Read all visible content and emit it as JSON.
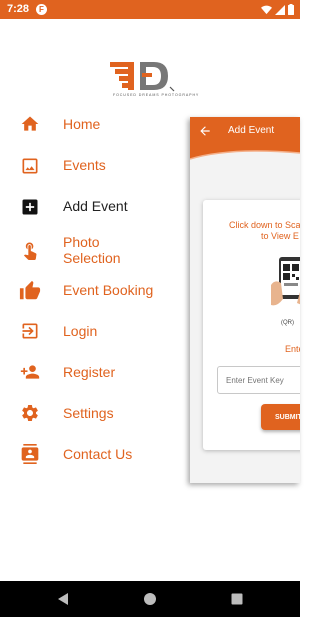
{
  "status_bar": {
    "time": "7:28",
    "app_icon_letter": "F",
    "icons": [
      "wifi-icon",
      "signal-icon",
      "battery-icon"
    ]
  },
  "logo": {
    "tagline": "FOCUSED DREAMS PHOTOGRAPHY",
    "colors": {
      "primary": "#e0631f",
      "secondary": "#777777"
    }
  },
  "menu": {
    "items": [
      {
        "label": "Home",
        "icon": "home-icon",
        "active": false
      },
      {
        "label": "Events",
        "icon": "image-icon",
        "active": false
      },
      {
        "label": "Add Event",
        "icon": "add-box-icon",
        "active": true
      },
      {
        "label": "Photo\nSelection",
        "icon": "touch-icon",
        "active": false
      },
      {
        "label": "Event Booking",
        "icon": "thumbs-up-icon",
        "active": false
      },
      {
        "label": "Login",
        "icon": "login-icon",
        "active": false
      },
      {
        "label": "Register",
        "icon": "person-add-icon",
        "active": false
      },
      {
        "label": "Settings",
        "icon": "gear-icon",
        "active": false
      },
      {
        "label": "Contact Us",
        "icon": "contact-icon",
        "active": false
      }
    ]
  },
  "preview": {
    "title": "Add Event",
    "scan_line1": "Click down to Sca",
    "scan_line2": "to View E",
    "qr_caption": "(QR)",
    "enter_label": "Enter Even",
    "input_placeholder": "Enter Event Key",
    "submit_label": "SUBMIT"
  },
  "theme": {
    "accent": "#e0631f",
    "active_text": "#222222"
  }
}
